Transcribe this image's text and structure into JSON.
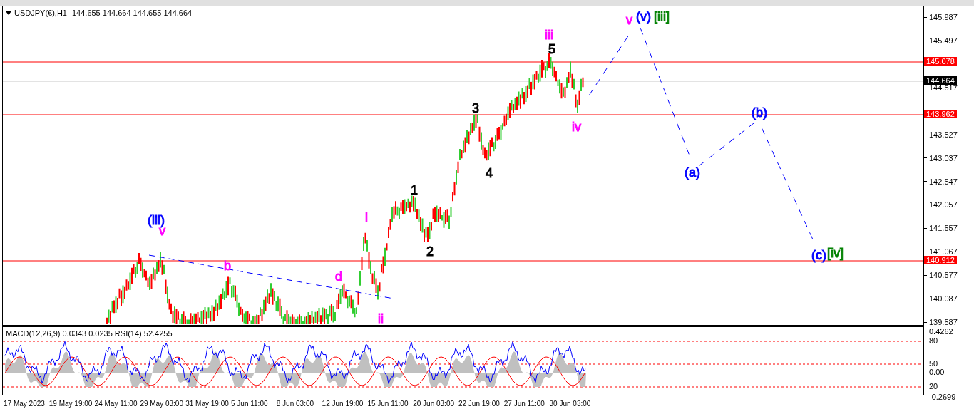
{
  "header": {
    "symbol": "USDJPY(€),H1",
    "quote": "144.655 144.664 144.655 144.664"
  },
  "price_axis": [
    "145.987",
    "145.497",
    "144.517",
    "143.527",
    "143.037",
    "142.547",
    "142.057",
    "141.557",
    "141.067",
    "140.577",
    "140.087",
    "139.587"
  ],
  "price_tags": [
    {
      "label": "145.078",
      "kind": "level"
    },
    {
      "label": "144.664",
      "kind": "current"
    },
    {
      "label": "143.962",
      "kind": "level"
    },
    {
      "label": "140.912",
      "kind": "level"
    }
  ],
  "wave_labels": [
    {
      "text": "(iii)",
      "color": "#0000ff"
    },
    {
      "text": "v",
      "color": "#ff00ff"
    },
    {
      "text": "b",
      "color": "#ff00ff"
    },
    {
      "text": "d",
      "color": "#ff00ff"
    },
    {
      "text": "i",
      "color": "#ff00ff"
    },
    {
      "text": "ii",
      "color": "#ff00ff"
    },
    {
      "text": "1",
      "color": "#000000"
    },
    {
      "text": "2",
      "color": "#000000"
    },
    {
      "text": "3",
      "color": "#000000"
    },
    {
      "text": "4",
      "color": "#000000"
    },
    {
      "text": "5",
      "color": "#000000"
    },
    {
      "text": "iii",
      "color": "#ff00ff"
    },
    {
      "text": "iv",
      "color": "#ff00ff"
    },
    {
      "text": "v",
      "color": "#ff00ff"
    },
    {
      "text": "(v)",
      "color": "#0000ff"
    },
    {
      "text": "[iii]",
      "color": "#008000"
    },
    {
      "text": "(a)",
      "color": "#0000ff"
    },
    {
      "text": "(b)",
      "color": "#0000ff"
    },
    {
      "text": "(c)",
      "color": "#0000ff"
    },
    {
      "text": "[iv]",
      "color": "#008000"
    }
  ],
  "indicator": {
    "label": "MACD(12,26,9) 0.0343 0.0235  RSI(14) 52.4255",
    "axis": [
      "0.4262",
      "80",
      "50",
      "0.00",
      "20",
      "-0.2699"
    ]
  },
  "dates": [
    "17 May 2023",
    "19 May 19:00",
    "24 May 11:00",
    "29 May 03:00",
    "31 May 19:00",
    "5 Jun 11:00",
    "8 Jun 03:00",
    "12 Jun 19:00",
    "15 Jun 11:00",
    "20 Jun 03:00",
    "22 Jun 19:00",
    "27 Jun 11:00",
    "30 Jun 03:00"
  ]
}
